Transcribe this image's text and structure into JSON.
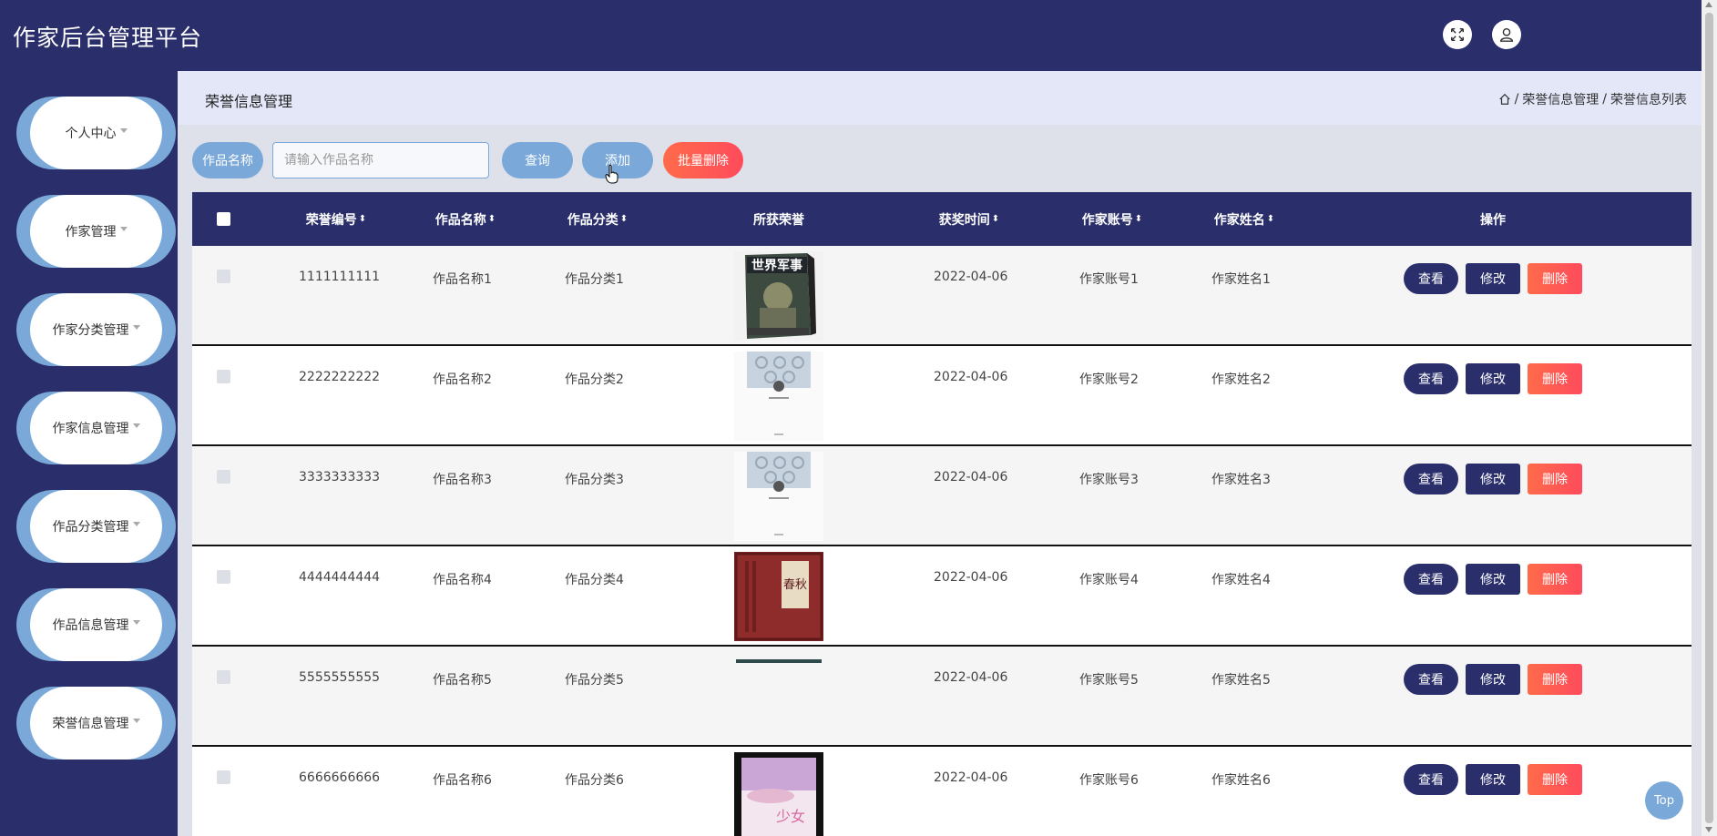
{
  "app": {
    "title": "作家后台管理平台"
  },
  "header": {
    "fullscreen_icon": "fullscreen-icon",
    "user_icon": "user-icon"
  },
  "sidebar": {
    "items": [
      {
        "label": "个人中心"
      },
      {
        "label": "作家管理"
      },
      {
        "label": "作家分类管理"
      },
      {
        "label": "作家信息管理"
      },
      {
        "label": "作品分类管理"
      },
      {
        "label": "作品信息管理"
      },
      {
        "label": "荣誉信息管理"
      }
    ]
  },
  "page": {
    "title": "荣誉信息管理",
    "breadcrumb": {
      "sep": "/",
      "level1": "荣誉信息管理",
      "level2": "荣誉信息列表"
    }
  },
  "search": {
    "label": "作品名称",
    "placeholder": "请输入作品名称",
    "value": "",
    "query_label": "查询",
    "add_label": "添加",
    "bulk_delete_label": "批量删除"
  },
  "table": {
    "columns": [
      "荣誉编号",
      "作品名称",
      "作品分类",
      "所获荣誉",
      "获奖时间",
      "作家账号",
      "作家姓名",
      "操作"
    ],
    "sort_glyph": "⬍",
    "rows": [
      {
        "id": "1111111111",
        "work": "作品名称1",
        "category": "作品分类1",
        "date": "2022-04-06",
        "account": "作家账号1",
        "name": "作家姓名1",
        "cover_title": "世界军事"
      },
      {
        "id": "2222222222",
        "work": "作品名称2",
        "category": "作品分类2",
        "date": "2022-04-06",
        "account": "作家账号2",
        "name": "作家姓名2"
      },
      {
        "id": "3333333333",
        "work": "作品名称3",
        "category": "作品分类3",
        "date": "2022-04-06",
        "account": "作家账号3",
        "name": "作家姓名3"
      },
      {
        "id": "4444444444",
        "work": "作品名称4",
        "category": "作品分类4",
        "date": "2022-04-06",
        "account": "作家账号4",
        "name": "作家姓名4",
        "cover_title": "春秋"
      },
      {
        "id": "5555555555",
        "work": "作品名称5",
        "category": "作品分类5",
        "date": "2022-04-06",
        "account": "作家账号5",
        "name": "作家姓名5"
      },
      {
        "id": "6666666666",
        "work": "作品名称6",
        "category": "作品分类6",
        "date": "2022-04-06",
        "account": "作家账号6",
        "name": "作家姓名6",
        "cover_title": "少女"
      }
    ],
    "actions": {
      "view": "查看",
      "edit": "修改",
      "delete": "删除"
    }
  },
  "top_button": "Top",
  "colors": {
    "primary": "#2a2f6b",
    "accent": "#79a8d9",
    "danger": "#ff4b5c"
  }
}
